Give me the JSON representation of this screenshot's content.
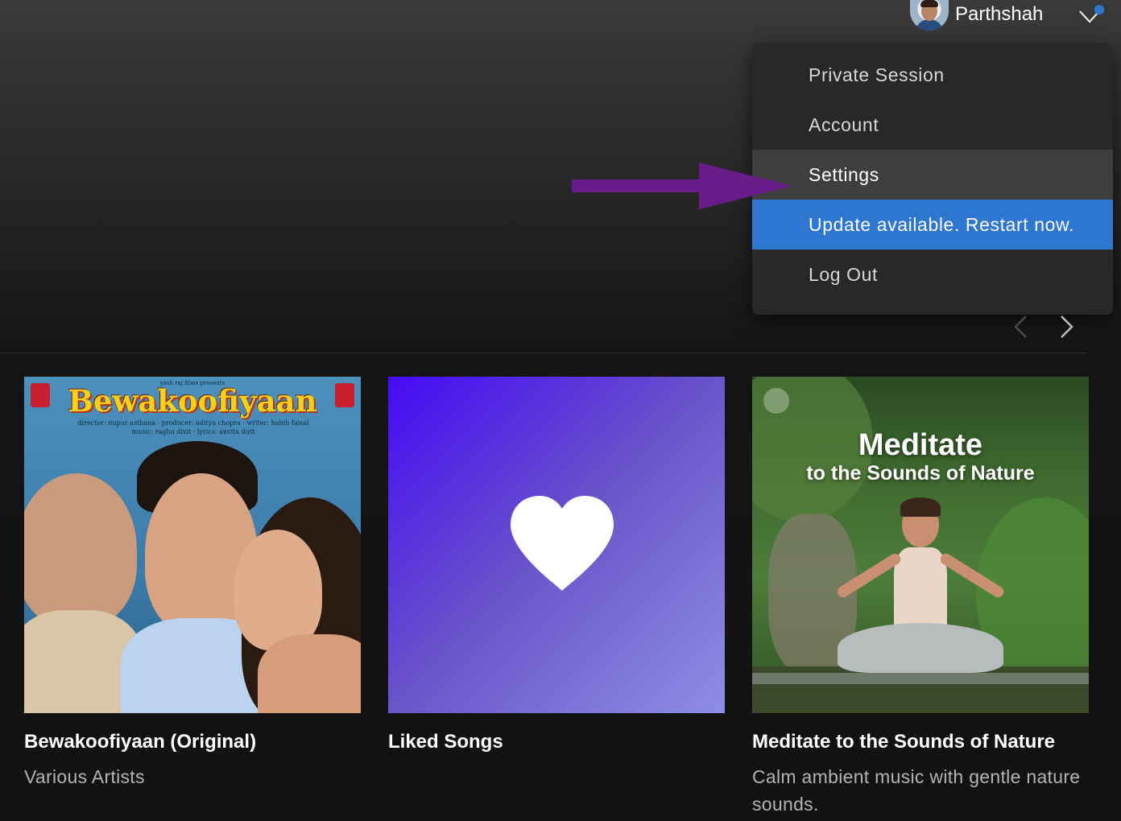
{
  "user": {
    "name": "Parthshah",
    "avatar_icon": "user-avatar",
    "notification_color": "#2e77d0"
  },
  "menu": {
    "items": [
      {
        "label": "Private Session"
      },
      {
        "label": "Account"
      },
      {
        "label": "Settings",
        "state": "hovered"
      },
      {
        "label": "Update available. Restart now.",
        "state": "highlighted"
      },
      {
        "label": "Log Out"
      }
    ],
    "highlight_color": "#2e77d0"
  },
  "annotation": {
    "arrow_color": "#6a1b8a",
    "points_to": "Settings"
  },
  "carousel": {
    "prev_icon": "chevron-left-icon",
    "next_icon": "chevron-right-icon"
  },
  "cards": [
    {
      "title": "Bewakoofiyaan (Original)",
      "subtitle": "Various Artists",
      "cover": {
        "type": "movie-poster",
        "banner": "yash raj films presents",
        "title": "Bewakoofiyaan",
        "credits": [
          "director: nupur asthana · producer: aditya chopra · writer: habib faisal",
          "music: raghu dixit · lyrics: anvita dutt"
        ]
      }
    },
    {
      "title": "Liked Songs",
      "subtitle": "",
      "cover": {
        "type": "liked-songs",
        "icon": "heart-icon"
      }
    },
    {
      "title": "Meditate to the Sounds of Nature",
      "subtitle": "Calm ambient music with gentle nature sounds.",
      "cover": {
        "type": "playlist-art",
        "title": "Meditate",
        "subtitle": "to the Sounds of Nature",
        "badge_icon": "spotify-logo-icon"
      }
    }
  ]
}
